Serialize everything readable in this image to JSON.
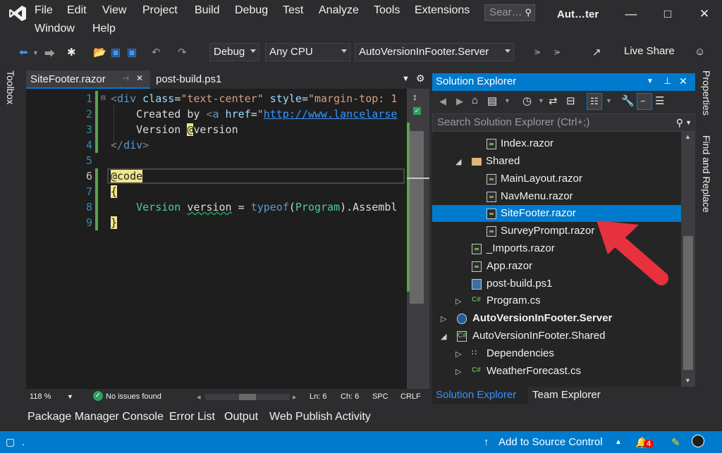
{
  "menu": {
    "items": [
      "File",
      "Edit",
      "View",
      "Project",
      "Build",
      "Debug",
      "Test",
      "Analyze",
      "Tools",
      "Extensions",
      "Window",
      "Help"
    ],
    "search_placeholder": "Sear…",
    "app_title": "Aut…ter"
  },
  "toolbar": {
    "config": "Debug",
    "platform": "Any CPU",
    "startup_project": "AutoVersionInFooter.Server",
    "live_share": "Live Share"
  },
  "side_left": {
    "toolbox": "Toolbox"
  },
  "side_right": {
    "properties": "Properties",
    "find_replace": "Find and Replace"
  },
  "editor": {
    "tabs": [
      {
        "label": "SiteFooter.razor",
        "active": true
      },
      {
        "label": "post-build.ps1",
        "active": false
      }
    ],
    "line_numbers": [
      "1",
      "2",
      "3",
      "4",
      "5",
      "6",
      "7",
      "8",
      "9"
    ],
    "lines": {
      "l1": {
        "open": "<",
        "el": "div",
        "attr1": " class",
        "eq1": "=",
        "val1": "\"text-center\"",
        "attr2": " style",
        "eq2": "=",
        "val2": "\"margin-top: 1"
      },
      "l2": {
        "text": "    Created by ",
        "open": "<",
        "el": "a",
        "attr": " href",
        "eq": "=",
        "q": "\"",
        "url": "http://www.lancelarse"
      },
      "l3": {
        "text": "    Version ",
        "at": "@",
        "rest": "version"
      },
      "l4": {
        "open": "</",
        "el": "div",
        "close": ">"
      },
      "l6": {
        "code": "@code"
      },
      "l7": {
        "brace": "{"
      },
      "l8": {
        "indent": "    ",
        "type1": "Version",
        "var": "version",
        "eq": " = ",
        "kw": "typeof",
        "p1": "(",
        "type2": "Program",
        "rest": ").Assembl"
      },
      "l9": {
        "brace": "}"
      }
    },
    "status": {
      "zoom": "118 %",
      "issues": "No issues found",
      "line": "Ln: 6",
      "col": "Ch: 6",
      "mode": "SPC",
      "eol": "CRLF"
    }
  },
  "bottom_tabs": [
    "Package Manager Console",
    "Error List",
    "Output",
    "Web Publish Activity"
  ],
  "solution_explorer": {
    "title": "Solution Explorer",
    "search_placeholder": "Search Solution Explorer (Ctrl+;)",
    "items": [
      {
        "label": "Index.razor",
        "icon": "razor-file-icon",
        "indent": 3,
        "expander": ""
      },
      {
        "label": "Shared",
        "icon": "folder-icon",
        "indent": 2,
        "expander": "◢"
      },
      {
        "label": "MainLayout.razor",
        "icon": "razor-file-icon",
        "indent": 3,
        "expander": ""
      },
      {
        "label": "NavMenu.razor",
        "icon": "razor-file-icon",
        "indent": 3,
        "expander": ""
      },
      {
        "label": "SiteFooter.razor",
        "icon": "razor-file-icon",
        "indent": 3,
        "expander": "",
        "selected": true
      },
      {
        "label": "SurveyPrompt.razor",
        "icon": "razor-file-icon",
        "indent": 3,
        "expander": ""
      },
      {
        "label": "_Imports.razor",
        "icon": "razor-file-icon",
        "indent": 2,
        "expander": ""
      },
      {
        "label": "App.razor",
        "icon": "razor-file-icon",
        "indent": 2,
        "expander": ""
      },
      {
        "label": "post-build.ps1",
        "icon": "script-file-icon",
        "indent": 2,
        "expander": ""
      },
      {
        "label": "Program.cs",
        "icon": "csharp-file-icon",
        "indent": 2,
        "expander": "▷"
      },
      {
        "label": "AutoVersionInFooter.Server",
        "icon": "web-project-icon",
        "indent": 0,
        "expander": "▷",
        "bold": true
      },
      {
        "label": "AutoVersionInFooter.Shared",
        "icon": "csharp-project-icon",
        "indent": 0,
        "expander": "◢"
      },
      {
        "label": "Dependencies",
        "icon": "dependencies-icon",
        "indent": 1,
        "expander": "▷"
      },
      {
        "label": "WeatherForecast.cs",
        "icon": "csharp-file-icon",
        "indent": 1,
        "expander": "▷"
      }
    ],
    "bottom_tabs": [
      "Solution Explorer",
      "Team Explorer"
    ]
  },
  "statusbar": {
    "left": ".",
    "source_control": "Add to Source Control",
    "notifications": "4"
  },
  "colors": {
    "accent": "#007acc",
    "arrow": "#e8313f"
  }
}
